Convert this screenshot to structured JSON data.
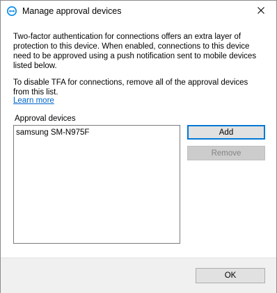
{
  "window": {
    "title": "Manage approval devices",
    "icon": "teamviewer-icon",
    "close_icon": "close-icon"
  },
  "description": {
    "paragraph1": "Two-factor authentication for connections offers an extra layer of protection to this device. When enabled, connections to this device need to be approved using a push notification sent to mobile devices listed below.",
    "paragraph2": "To disable TFA for connections, remove all of the approval devices from this list.",
    "learn_more": "Learn more"
  },
  "devices": {
    "label": "Approval devices",
    "items": [
      "samsung SM-N975F"
    ]
  },
  "buttons": {
    "add": "Add",
    "remove": "Remove",
    "ok": "OK"
  },
  "colors": {
    "accent": "#0078d7",
    "link": "#0066cc"
  }
}
